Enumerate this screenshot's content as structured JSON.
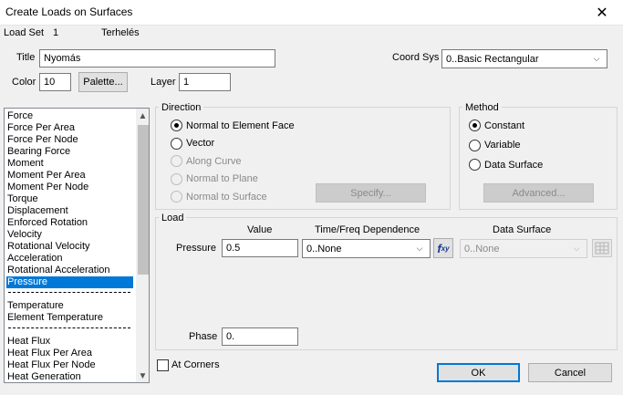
{
  "window": {
    "title": "Create Loads on Surfaces",
    "close": "✕"
  },
  "header": {
    "load_set_label": "Load Set",
    "load_set_value": "1",
    "load_set_name": "Terhelés",
    "title_label": "Title",
    "title_value": "Nyomás",
    "coord_label": "Coord Sys",
    "coord_value": "0..Basic Rectangular",
    "color_label": "Color",
    "color_value": "10",
    "palette_button": "Palette...",
    "layer_label": "Layer",
    "layer_value": "1"
  },
  "load_types": {
    "items": [
      "Force",
      "Force Per Area",
      "Force Per Node",
      "Bearing Force",
      "Moment",
      "Moment Per Area",
      "Moment Per Node",
      "Torque",
      "Displacement",
      "Enforced Rotation",
      "Velocity",
      "Rotational Velocity",
      "Acceleration",
      "Rotational Acceleration",
      "Pressure"
    ],
    "selected": "Pressure",
    "thermal_items": [
      "Temperature",
      "Element Temperature"
    ],
    "heat_items": [
      "Heat Flux",
      "Heat Flux Per Area",
      "Heat Flux Per Node",
      "Heat Generation"
    ]
  },
  "direction": {
    "title": "Direction",
    "options": [
      {
        "label": "Normal to Element Face",
        "checked": true,
        "enabled": true
      },
      {
        "label": "Vector",
        "checked": false,
        "enabled": true
      },
      {
        "label": "Along Curve",
        "checked": false,
        "enabled": false
      },
      {
        "label": "Normal to Plane",
        "checked": false,
        "enabled": false
      },
      {
        "label": "Normal to Surface",
        "checked": false,
        "enabled": false
      }
    ],
    "specify_button": "Specify..."
  },
  "method": {
    "title": "Method",
    "options": [
      {
        "label": "Constant",
        "checked": true
      },
      {
        "label": "Variable",
        "checked": false
      },
      {
        "label": "Data Surface",
        "checked": false
      }
    ],
    "advanced_button": "Advanced..."
  },
  "load": {
    "title": "Load",
    "col_value": "Value",
    "col_time": "Time/Freq Dependence",
    "col_surface": "Data Surface",
    "pressure_label": "Pressure",
    "pressure_value": "0.5",
    "time_value": "0..None",
    "fxy_f": "f",
    "fxy_xy": "xy",
    "surface_value": "0..None",
    "phase_label": "Phase",
    "phase_value": "0."
  },
  "footer": {
    "at_corners": "At Corners",
    "ok": "OK",
    "cancel": "Cancel"
  }
}
